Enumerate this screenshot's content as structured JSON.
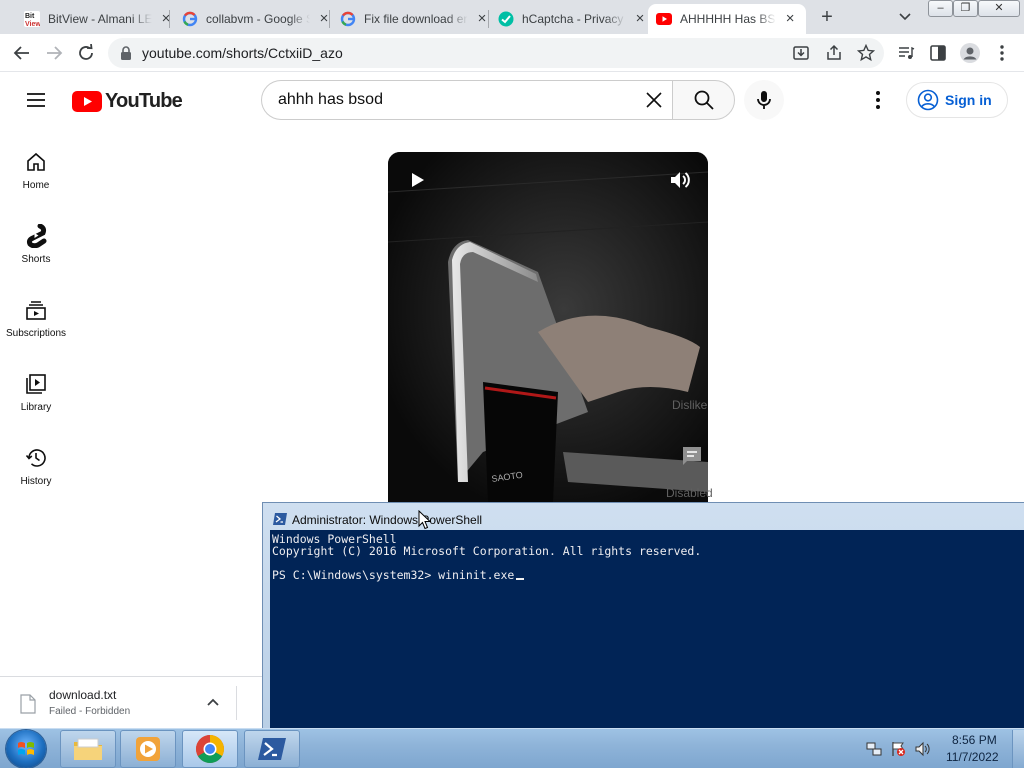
{
  "browser": {
    "tabs": [
      {
        "title": "BitView - Almani LE",
        "favicon": "bitview-icon",
        "active": false
      },
      {
        "title": "collabvm - Google S",
        "favicon": "google-icon",
        "active": false
      },
      {
        "title": "Fix file download er",
        "favicon": "google-icon",
        "active": false
      },
      {
        "title": "hCaptcha - Privacy",
        "favicon": "hcaptcha-icon",
        "active": false
      },
      {
        "title": "AHHHHH Has BSOD",
        "favicon": "youtube-icon",
        "active": true
      }
    ],
    "new_tab_label": "+",
    "url": "youtube.com/shorts/CctxiiD_azo"
  },
  "youtube": {
    "logo_text": "YouTube",
    "search_query": "ahhh has bsod",
    "signin_label": "Sign in",
    "guide": [
      {
        "label": "Home",
        "icon": "home-icon"
      },
      {
        "label": "Shorts",
        "icon": "shorts-icon"
      },
      {
        "label": "Subscriptions",
        "icon": "subscriptions-icon"
      },
      {
        "label": "Library",
        "icon": "library-icon"
      },
      {
        "label": "History",
        "icon": "history-icon"
      }
    ],
    "dislike_label": "Dislike",
    "comments_label": "Disabled"
  },
  "download": {
    "filename": "download.txt",
    "status": "Failed - Forbidden"
  },
  "powershell": {
    "title": "Administrator: Windows PowerShell",
    "lines": [
      "Windows PowerShell",
      "Copyright (C) 2016 Microsoft Corporation. All rights reserved.",
      "",
      "PS C:\\Windows\\system32> wininit.exe"
    ]
  },
  "taskbar": {
    "apps": [
      "explorer-icon",
      "media-player-icon",
      "chrome-icon",
      "powershell-icon"
    ],
    "time": "8:56 PM",
    "date": "11/7/2022"
  },
  "colors": {
    "youtube_red": "#ff0000",
    "signin_blue": "#065fd4",
    "powershell_bg": "#012456"
  }
}
